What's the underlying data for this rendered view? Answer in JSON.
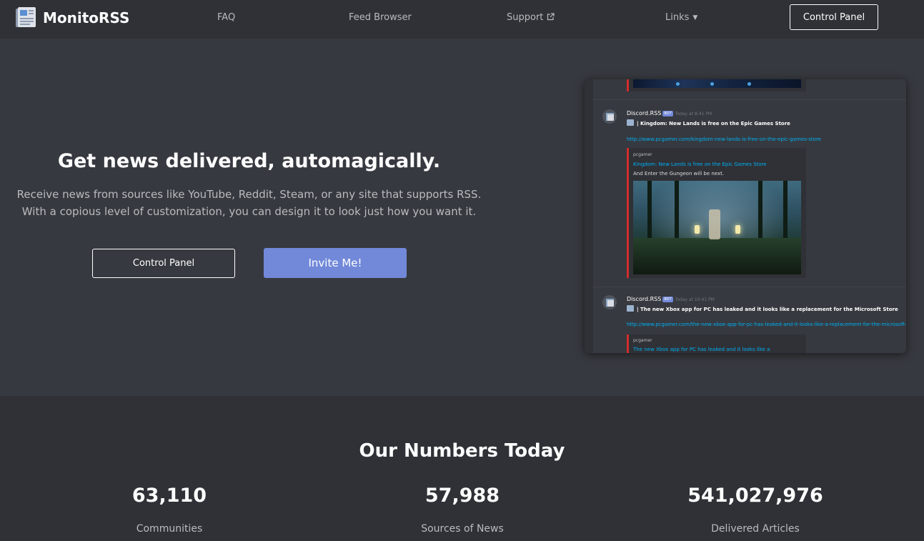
{
  "nav": {
    "brand": "MonitoRSS",
    "links": [
      {
        "label": "FAQ"
      },
      {
        "label": "Feed Browser"
      },
      {
        "label": "Support",
        "icon": "external-link-icon"
      },
      {
        "label": "Links",
        "icon": "caret-down-icon"
      }
    ],
    "control_panel": "Control Panel"
  },
  "hero": {
    "title": "Get news delivered, automagically.",
    "desc1": "Receive news from sources like YouTube, Reddit, Steam, or any site that supports RSS.",
    "desc2": "With a copious level of customization, you can design it to look just how you want it.",
    "btn_control_panel": "Control Panel",
    "btn_invite": "Invite Me!"
  },
  "preview": {
    "messages": [
      {
        "author": "Discord.RSS",
        "badge": "BOT",
        "time": "Today at 8:41 PM",
        "text": "|  Kingdom: New Lands is free on the Epic Games Store",
        "link": "http://www.pcgamer.com/kingdom-new-lands-is-free-on-the-epic-games-store",
        "provider": "pcgamer",
        "embed_title": "Kingdom: New Lands is free on the Epic Games Store",
        "embed_desc": "And Enter the Gungeon will be next."
      },
      {
        "author": "Discord.RSS",
        "badge": "BOT",
        "time": "Today at 10:41 PM",
        "text": "|  The new Xbox app for PC has leaked and it looks like a replacement for the Microsoft Store",
        "link": "http://www.pcgamer.com/the-new-xbox-app-for-pc-has-leaked-and-it-looks-like-a-replacement-for-the-microsoft-store",
        "provider": "pcgamer",
        "embed_title": "The new Xbox app for PC has leaked and it looks like a"
      }
    ]
  },
  "stats": {
    "title": "Our Numbers Today",
    "items": [
      {
        "value": "63,110",
        "label": "Communities",
        "sub": ""
      },
      {
        "value": "57,988",
        "label": "Sources of News",
        "sub": ""
      },
      {
        "value": "541,027,976",
        "label": "Delivered Articles",
        "sub": ""
      }
    ]
  },
  "colors": {
    "accent": "#7289da",
    "background": "#36393f",
    "navbar": "#2f3136",
    "embed_bar": "#d12c2c",
    "link": "#00b0f4"
  }
}
